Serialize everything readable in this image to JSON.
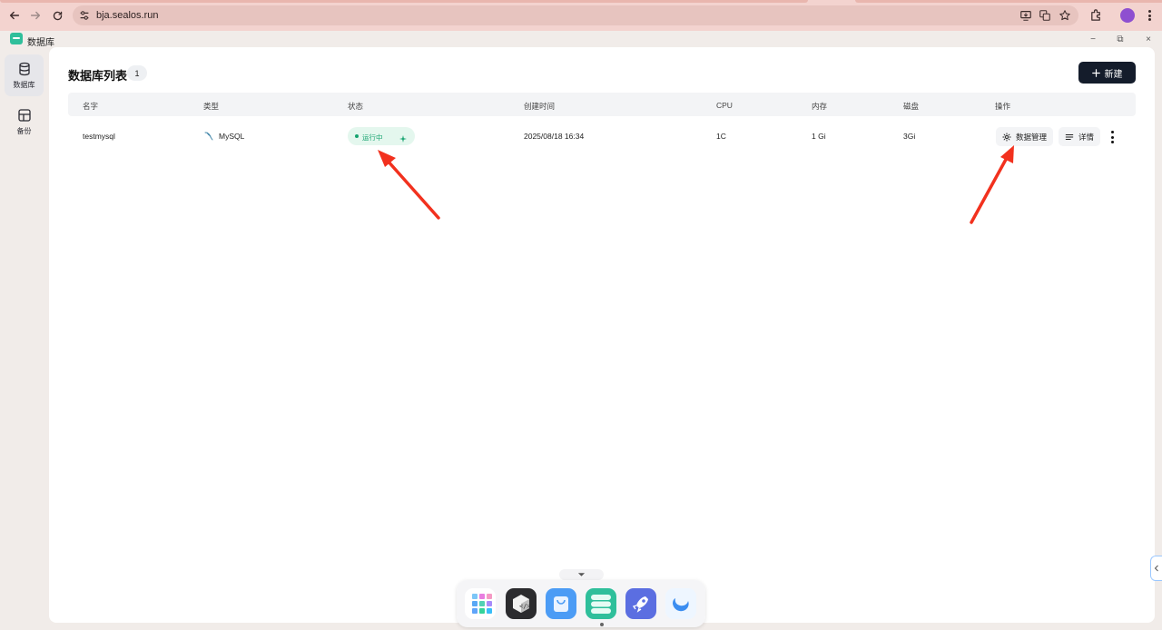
{
  "browser": {
    "url": "bja.sealos.run"
  },
  "app": {
    "title": "数据库",
    "window_controls": [
      "−",
      "⧉",
      "×"
    ]
  },
  "sidebar": {
    "items": [
      {
        "label": "数据库",
        "icon": "database-icon",
        "active": true
      },
      {
        "label": "备份",
        "icon": "backup-icon",
        "active": false
      }
    ]
  },
  "main": {
    "title": "数据库列表",
    "count": "1",
    "new_button_label": "新建",
    "table": {
      "headers": [
        "名字",
        "类型",
        "状态",
        "创建时间",
        "CPU",
        "内存",
        "磁盘",
        "操作"
      ],
      "rows": [
        {
          "name": "testmysql",
          "type": "MySQL",
          "status": "运行中",
          "created": "2025/08/18 16:34",
          "cpu": "1C",
          "memory": "1 Gi",
          "disk": "3Gi",
          "actions": {
            "manage": "数据管理",
            "detail": "详情"
          }
        }
      ]
    }
  },
  "colors": {
    "accent_dark": "#141c2b",
    "status_green": "#15a36f",
    "arrow_red": "#f2311e"
  },
  "dock": {
    "apps": [
      "app-grid-icon",
      "devbox-icon",
      "app-store-icon",
      "database-app-icon",
      "launchpad-icon",
      "cloud-wave-icon"
    ]
  }
}
